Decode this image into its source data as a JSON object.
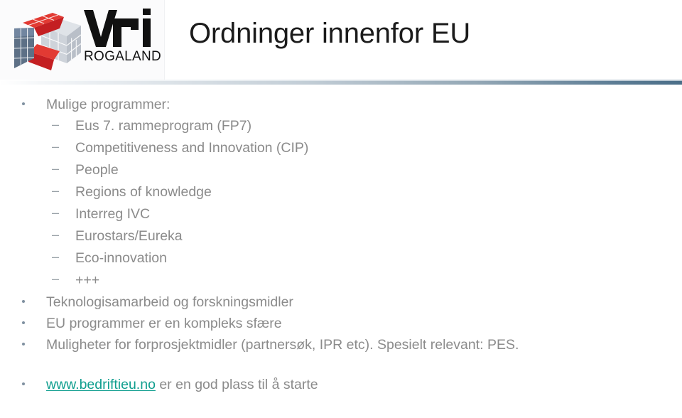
{
  "slide": {
    "title": "Ordninger innenfor EU",
    "logo": {
      "wordmark": "VRI",
      "subtitle": "ROGALAND",
      "icon_name": "vri-cube-logo",
      "colors": {
        "red": "#d8262a",
        "blue_gray": "#5a6f8a",
        "light_gray": "#c9ced6",
        "text": "#111111"
      }
    },
    "divider": {
      "gradient_from": "#ffffff",
      "gradient_to": "#4a6e88"
    },
    "theme": {
      "body_text": "#8b8b8b",
      "title_text": "#1b1b1b",
      "bullet_marker": "#7f90a0",
      "dash_marker": "#9aa2a8",
      "link": "#0f9e8e"
    },
    "bullets": [
      {
        "level": 1,
        "marker": "dot",
        "text": "Mulige programmer:"
      },
      {
        "level": 2,
        "marker": "dash",
        "text": "Eus 7. rammeprogram (FP7)"
      },
      {
        "level": 2,
        "marker": "dash",
        "text": "Competitiveness and Innovation (CIP)"
      },
      {
        "level": 2,
        "marker": "dash",
        "text": "People"
      },
      {
        "level": 2,
        "marker": "dash",
        "text": "Regions of knowledge"
      },
      {
        "level": 2,
        "marker": "dash",
        "text": "Interreg IVC"
      },
      {
        "level": 2,
        "marker": "dash",
        "text": "Eurostars/Eureka"
      },
      {
        "level": 2,
        "marker": "dash",
        "text": "Eco-innovation"
      },
      {
        "level": 2,
        "marker": "dash",
        "text": "+++"
      },
      {
        "level": 1,
        "marker": "dot",
        "text": "Teknologisamarbeid og forskningsmidler"
      },
      {
        "level": 1,
        "marker": "dot",
        "text": "EU programmer er en kompleks sfære"
      },
      {
        "level": 1,
        "marker": "dot",
        "text": "Muligheter for forprosjektmidler (partnersøk, IPR etc). Spesielt relevant: PES."
      }
    ],
    "last_bullet": {
      "marker": "dot",
      "link_text": "www.bedriftieu.no",
      "rest_text": " er en god plass til å starte"
    },
    "markers": {
      "dot": "•",
      "dash": "–"
    }
  }
}
